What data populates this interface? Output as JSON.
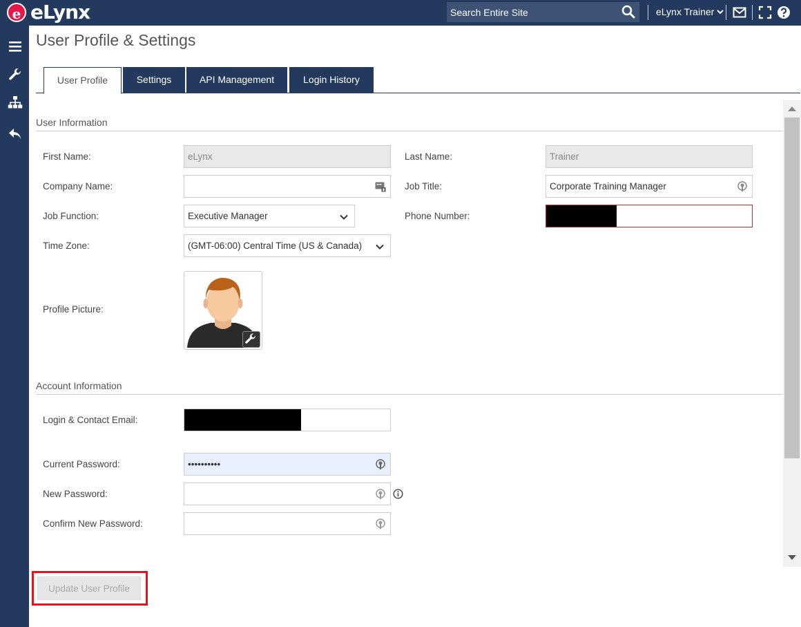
{
  "brand": {
    "logo_mark": "e",
    "logo_text": "eLynx"
  },
  "header": {
    "search_placeholder": "Search Entire Site",
    "user_name": "eLynx Trainer",
    "icons": [
      "search-icon",
      "chevron-down-icon",
      "mail-icon",
      "fullscreen-icon",
      "help-icon"
    ]
  },
  "sidebar": {
    "icons": [
      "menu-icon",
      "wrench-icon",
      "org-chart-icon",
      "back-icon"
    ]
  },
  "page_title": "User Profile & Settings",
  "tabs": [
    {
      "label": "User Profile",
      "active": true
    },
    {
      "label": "Settings",
      "active": false
    },
    {
      "label": "API Management",
      "active": false
    },
    {
      "label": "Login History",
      "active": false
    }
  ],
  "user_info": {
    "section_title": "User Information",
    "first_name_label": "First Name:",
    "first_name_value": "eLynx",
    "last_name_label": "Last Name:",
    "last_name_value": "Trainer",
    "company_label": "Company Name:",
    "company_value": "",
    "job_title_label": "Job Title:",
    "job_title_value": "Corporate Training Manager",
    "job_function_label": "Job Function:",
    "job_function_value": "Executive Manager",
    "phone_label": "Phone Number:",
    "time_zone_label": "Time Zone:",
    "time_zone_value": "(GMT-06:00) Central Time (US & Canada)",
    "profile_picture_label": "Profile Picture:"
  },
  "account_info": {
    "section_title": "Account Information",
    "email_label": "Login & Contact Email:",
    "current_password_label": "Current Password:",
    "current_password_value": "••••••••••",
    "new_password_label": "New Password:",
    "confirm_password_label": "Confirm New Password:"
  },
  "update_button_label": "Update User Profile",
  "colors": {
    "navy": "#233a5e",
    "brand_red": "#e8174b",
    "highlight_red": "#e3141c"
  }
}
